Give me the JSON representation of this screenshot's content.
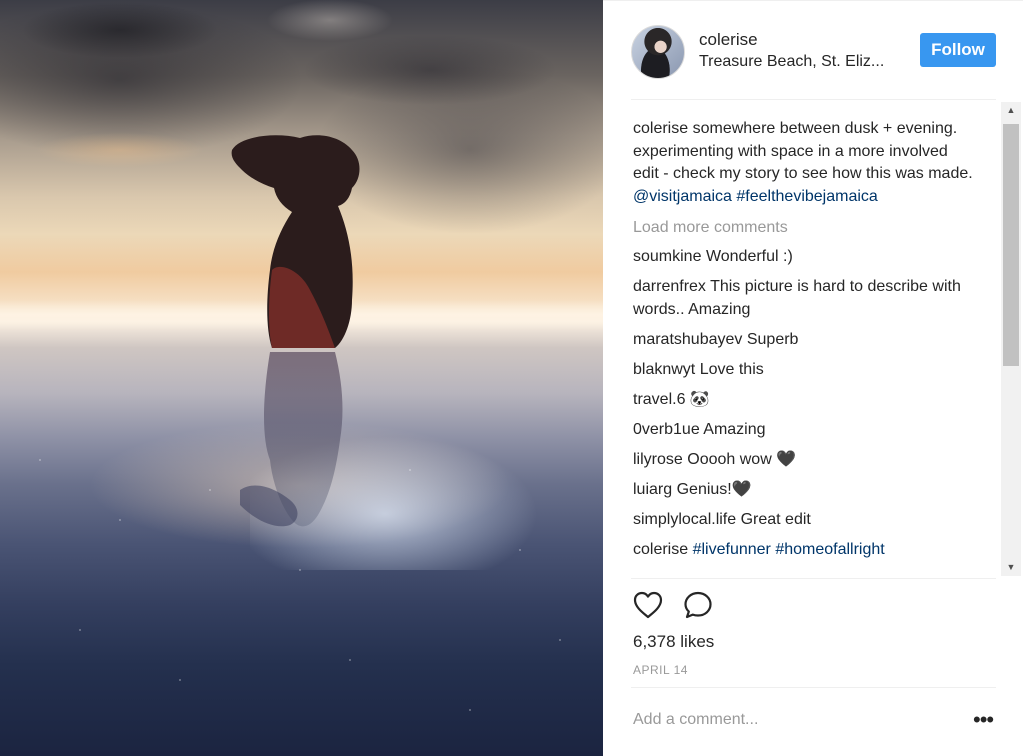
{
  "post": {
    "username": "colerise",
    "location": "Treasure Beach, St. Eliz...",
    "follow_label": "Follow"
  },
  "caption": {
    "author": "colerise",
    "text": "somewhere between dusk + evening. experimenting with space in a more involved edit - check my story to see how this was made.",
    "mention": "@visitjamaica",
    "hashtag": "#feelthevibejamaica"
  },
  "load_more": "Load more comments",
  "comments": [
    {
      "author": "soumkine",
      "text": "Wonderful :)"
    },
    {
      "author": "darrenfrex",
      "text": "This picture is hard to describe with words.. Amazing"
    },
    {
      "author": "maratshubayev",
      "text": "Superb"
    },
    {
      "author": "blaknwyt",
      "text": "Love this"
    },
    {
      "author": "travel.6",
      "text": "🐼"
    },
    {
      "author": "0verb1ue",
      "text": "Amazing"
    },
    {
      "author": "lilyrose",
      "text": "Ooooh wow 🖤"
    },
    {
      "author": "luiarg",
      "text": "Genius!🖤"
    },
    {
      "author": "simplylocal.life",
      "text": "Great edit"
    },
    {
      "author": "colerise",
      "text": "#livefunner #homeofallright"
    }
  ],
  "likes": "6,378 likes",
  "date": "APRIL 14",
  "add_comment_placeholder": "Add a comment...",
  "more_glyph": "•••",
  "icons": {
    "like": "heart-icon",
    "comment": "comment-bubble-icon",
    "more": "more-options-icon",
    "scroll_up": "▲",
    "scroll_down": "▼"
  },
  "colors": {
    "follow_button": "#3897f0",
    "link": "#003569",
    "muted_text": "#999999"
  }
}
